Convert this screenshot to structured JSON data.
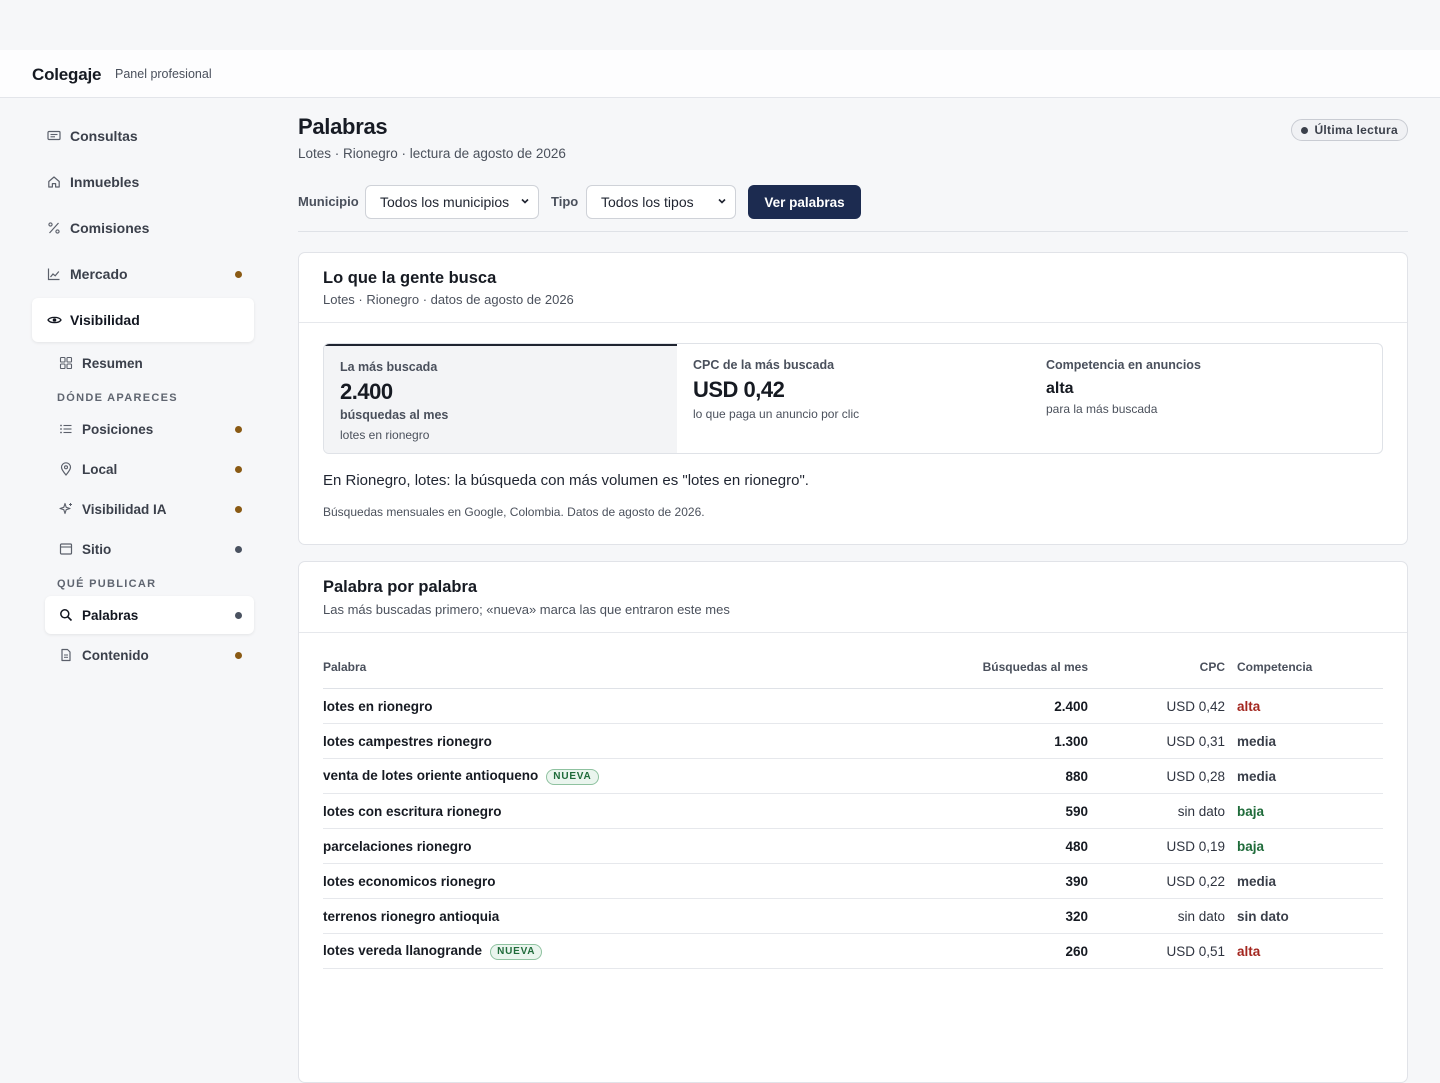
{
  "app": {
    "brand": "Colegaje",
    "subtitle": "Panel profesional"
  },
  "sidebar": {
    "items": [
      {
        "label": "Consultas",
        "icon": "chat-icon",
        "dot": null
      },
      {
        "label": "Inmuebles",
        "icon": "home-icon",
        "dot": null
      },
      {
        "label": "Comisiones",
        "icon": "percent-icon",
        "dot": null
      },
      {
        "label": "Mercado",
        "icon": "chart-icon",
        "dot": "#8a5a14"
      },
      {
        "label": "Visibilidad",
        "icon": "eye-icon",
        "dot": null,
        "active": true
      }
    ],
    "summary": {
      "label": "Resumen",
      "icon": "grid-icon"
    },
    "section_where": "DÓNDE APARECES",
    "where_items": [
      {
        "label": "Posiciones",
        "icon": "list-icon",
        "dot": "#8a5a14"
      },
      {
        "label": "Local",
        "icon": "pin-icon",
        "dot": "#8a5a14"
      },
      {
        "label": "Visibilidad IA",
        "icon": "sparkle-icon",
        "dot": "#8a5a14"
      },
      {
        "label": "Sitio",
        "icon": "browser-icon",
        "dot": "#4a5260"
      }
    ],
    "section_publish": "QUÉ PUBLICAR",
    "publish_items": [
      {
        "label": "Palabras",
        "icon": "search-icon",
        "dot": "#4a5260",
        "active": true
      },
      {
        "label": "Contenido",
        "icon": "document-icon",
        "dot": "#8a5a14"
      }
    ]
  },
  "page": {
    "title": "Palabras",
    "subtitle": "Lotes · Rionegro · lectura de agosto de 2026",
    "badge": "Última lectura"
  },
  "filters": {
    "municipio_label": "Municipio",
    "municipio_value": "Todos los municipios",
    "tipo_label": "Tipo",
    "tipo_value": "Todos los tipos",
    "submit": "Ver palabras"
  },
  "summary_card": {
    "title": "Lo que la gente busca",
    "subtitle": "Lotes · Rionegro · datos de agosto de 2026",
    "metric1": {
      "label": "La más buscada",
      "value": "2.400",
      "unit": "búsquedas al mes",
      "note": "lotes en rionegro"
    },
    "metric2": {
      "label": "CPC de la más buscada",
      "value": "USD 0,42",
      "note": "lo que paga un anuncio por clic"
    },
    "metric3": {
      "label": "Competencia en anuncios",
      "value": "alta",
      "note": "para la más buscada"
    },
    "insight": "En Rionegro, lotes: la búsqueda con más volumen es \"lotes en rionegro\".",
    "source": "Búsquedas mensuales en Google, Colombia. Datos de agosto de 2026."
  },
  "table_card": {
    "title": "Palabra por palabra",
    "subtitle": "Las más buscadas primero; «nueva» marca las que entraron este mes",
    "columns": [
      "Palabra",
      "Búsquedas al mes",
      "CPC",
      "Competencia"
    ],
    "new_tag": "NUEVA",
    "rows": [
      {
        "word": "lotes en rionegro",
        "new": false,
        "volume": "2.400",
        "cpc": "USD 0,42",
        "competition": "alta",
        "level": "alta"
      },
      {
        "word": "lotes campestres rionegro",
        "new": false,
        "volume": "1.300",
        "cpc": "USD 0,31",
        "competition": "media",
        "level": "media"
      },
      {
        "word": "venta de lotes oriente antioqueno",
        "new": true,
        "volume": "880",
        "cpc": "USD 0,28",
        "competition": "media",
        "level": "media"
      },
      {
        "word": "lotes con escritura rionegro",
        "new": false,
        "volume": "590",
        "cpc": "sin dato",
        "competition": "baja",
        "level": "baja"
      },
      {
        "word": "parcelaciones rionegro",
        "new": false,
        "volume": "480",
        "cpc": "USD 0,19",
        "competition": "baja",
        "level": "baja"
      },
      {
        "word": "lotes economicos rionegro",
        "new": false,
        "volume": "390",
        "cpc": "USD 0,22",
        "competition": "media",
        "level": "media"
      },
      {
        "word": "terrenos rionegro antioquia",
        "new": false,
        "volume": "320",
        "cpc": "sin dato",
        "competition": "sin dato",
        "level": "none"
      },
      {
        "word": "lotes vereda llanogrande",
        "new": true,
        "volume": "260",
        "cpc": "USD 0,51",
        "competition": "alta",
        "level": "alta"
      }
    ]
  }
}
